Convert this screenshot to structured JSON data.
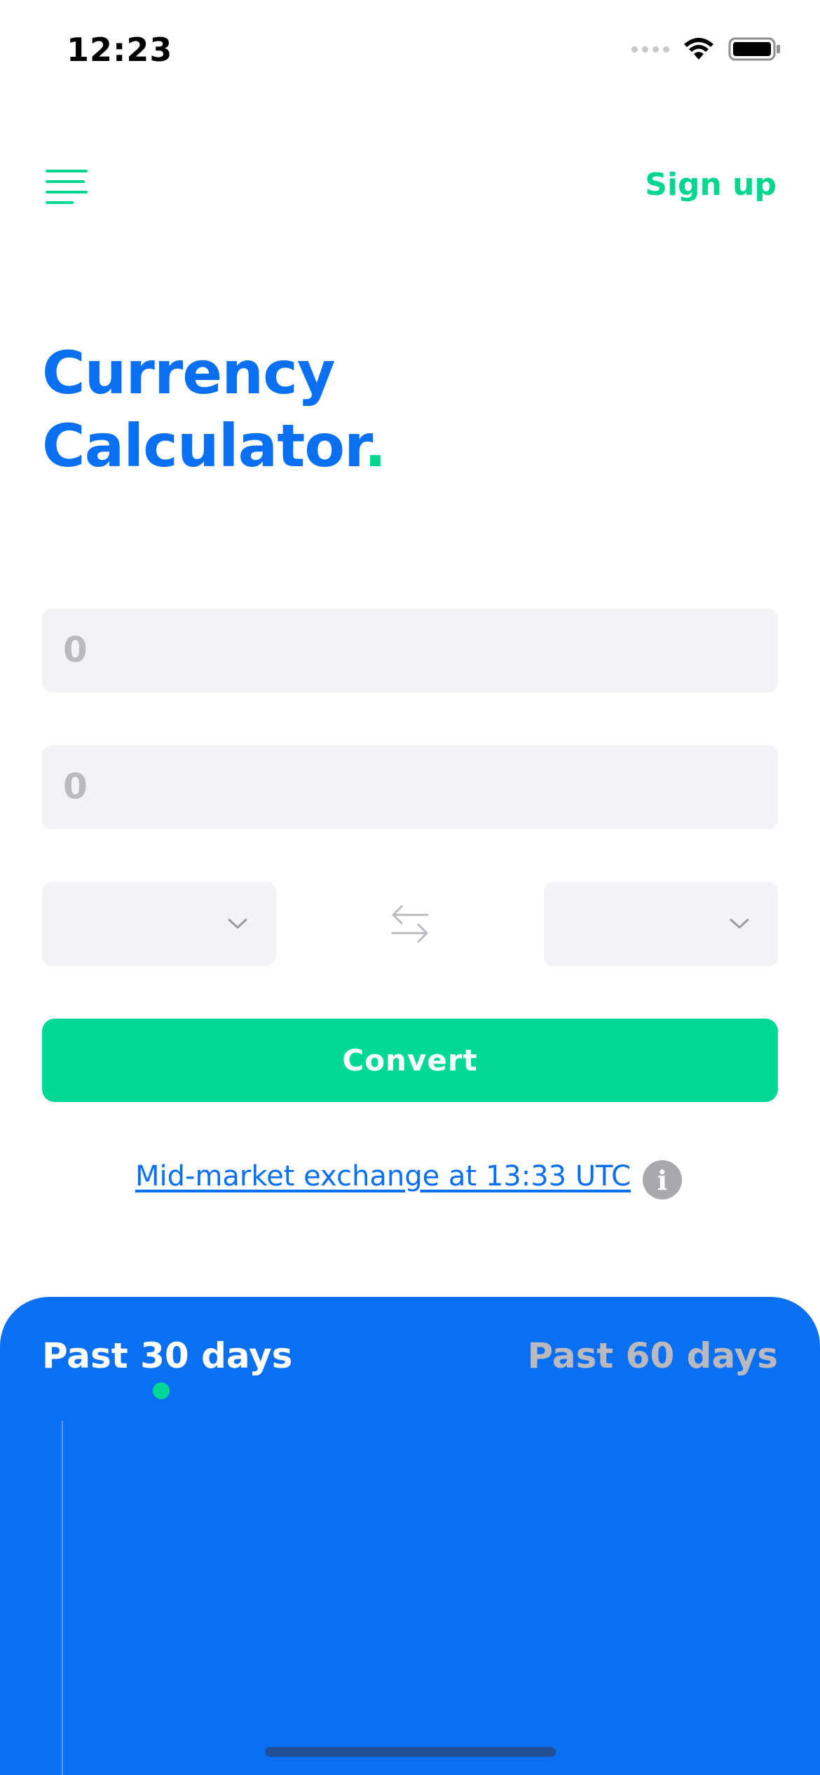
{
  "status_bar": {
    "time": "12:23"
  },
  "header": {
    "signup_label": "Sign up"
  },
  "title": {
    "line1": "Currency",
    "line2": "Calculator",
    "dot": "."
  },
  "inputs": {
    "amount_from": "0",
    "amount_to": "0"
  },
  "currency_select": {
    "from_value": "",
    "to_value": ""
  },
  "convert_label": "Convert",
  "rate_info": {
    "link_text": "Mid-market exchange at 13:33 UTC",
    "info_glyph": "i"
  },
  "chart_panel": {
    "tabs": [
      {
        "label": "Past 30 days",
        "active": true
      },
      {
        "label": "Past 60 days",
        "active": false
      }
    ]
  },
  "colors": {
    "brand_blue": "#0a6ff0",
    "accent_green": "#00d896",
    "field_bg": "#f2f2f7",
    "placeholder": "#b9b9bf"
  },
  "icons": [
    "menu-icon",
    "signal-icon",
    "wifi-icon",
    "battery-icon",
    "chevron-down-icon",
    "swap-arrows-icon",
    "info-icon"
  ]
}
